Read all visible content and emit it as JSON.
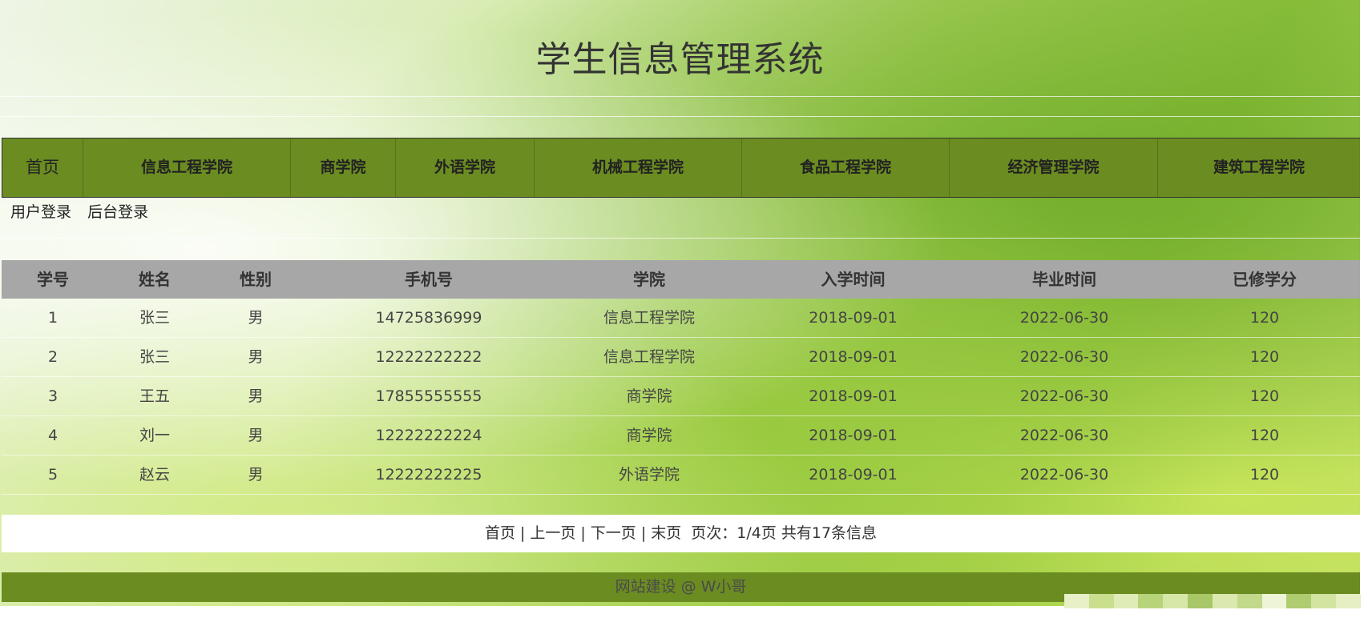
{
  "title": "学生信息管理系统",
  "nav": {
    "items": [
      "首页",
      "信息工程学院",
      "商学院",
      "外语学院",
      "机械工程学院",
      "食品工程学院",
      "经济管理学院",
      "建筑工程学院"
    ]
  },
  "login": {
    "user_login": "用户登录",
    "admin_login": "后台登录"
  },
  "table": {
    "headers": [
      "学号",
      "姓名",
      "性别",
      "手机号",
      "学院",
      "入学时间",
      "毕业时间",
      "已修学分"
    ],
    "rows": [
      [
        "1",
        "张三",
        "男",
        "14725836999",
        "信息工程学院",
        "2018-09-01",
        "2022-06-30",
        "120"
      ],
      [
        "2",
        "张三",
        "男",
        "12222222222",
        "信息工程学院",
        "2018-09-01",
        "2022-06-30",
        "120"
      ],
      [
        "3",
        "王五",
        "男",
        "17855555555",
        "商学院",
        "2018-09-01",
        "2022-06-30",
        "120"
      ],
      [
        "4",
        "刘一",
        "男",
        "12222222224",
        "商学院",
        "2018-09-01",
        "2022-06-30",
        "120"
      ],
      [
        "5",
        "赵云",
        "男",
        "12222222225",
        "外语学院",
        "2018-09-01",
        "2022-06-30",
        "120"
      ]
    ]
  },
  "pager": {
    "first": "首页",
    "prev": "上一页",
    "next": "下一页",
    "last": "末页",
    "separator": "|",
    "info": "页次：1/4页 共有17条信息"
  },
  "footer": {
    "text": "网站建设 @ W小哥"
  },
  "colors": {
    "nav_bg": "#6b8c21",
    "table_header_bg": "#a7a7a7",
    "pager_bg": "#ffffff",
    "footer_bg": "#6b8c21"
  }
}
